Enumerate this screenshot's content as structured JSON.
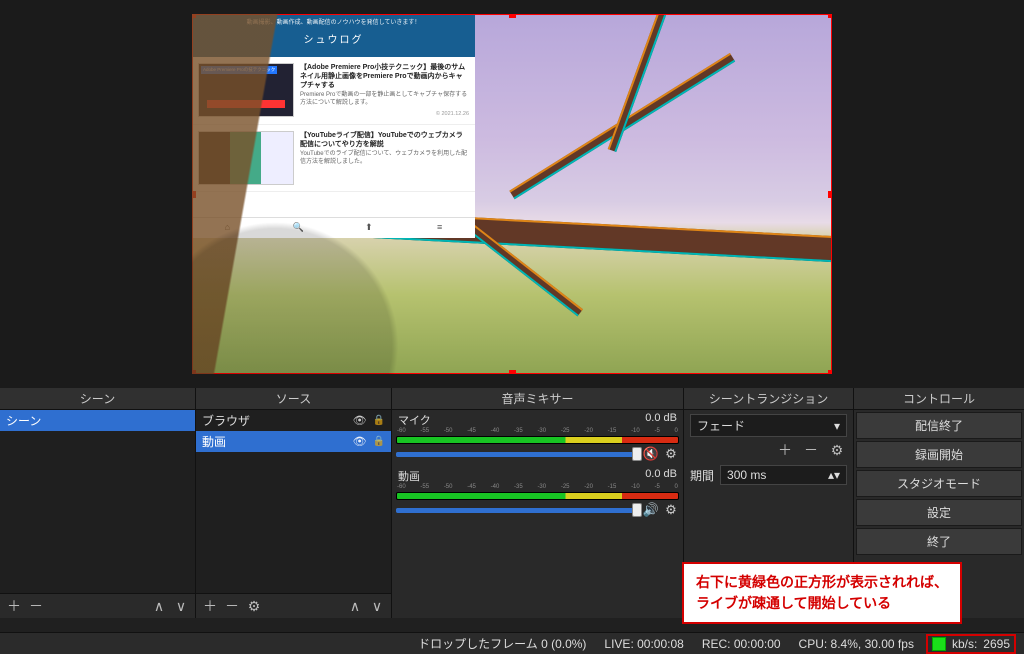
{
  "preview": {
    "browser_source": {
      "header_tagline": "動画撮影、動画作成、動画配信のノウハウを発信していきます！",
      "header_title": "シュウログ",
      "articles": [
        {
          "title": "【Adobe Premiere Pro小技テクニック】最後のサムネイル用静止画像をPremiere Proで動画内からキャプチャする",
          "desc": "Premiere Proで動画の一部を静止画としてキャプチャ保存する方法について解説します。",
          "date": "© 2021.12.26"
        },
        {
          "title": "【YouTubeライブ配信】YouTubeでのウェブカメラ配信についてやり方を解説",
          "desc": "YouTubeでのライブ配信について、ウェブカメラを利用した配信方法を解説しました。",
          "date": ""
        }
      ],
      "nav_icons": [
        "home-icon",
        "search-icon",
        "upload-icon",
        "menu-icon"
      ]
    }
  },
  "docks": {
    "scenes": {
      "title": "シーン",
      "items": [
        "シーン"
      ]
    },
    "sources": {
      "title": "ソース",
      "items": [
        {
          "name": "ブラウザ",
          "selected": false
        },
        {
          "name": "動画",
          "selected": true
        }
      ]
    },
    "mixer": {
      "title": "音声ミキサー",
      "channels": [
        {
          "name": "マイク",
          "db": "0.0 dB",
          "muted": true
        },
        {
          "name": "動画",
          "db": "0.0 dB",
          "muted": false
        }
      ],
      "scale": [
        "-60",
        "-55",
        "-50",
        "-45",
        "-40",
        "-35",
        "-30",
        "-25",
        "-20",
        "-15",
        "-10",
        "-5",
        "0"
      ]
    },
    "transitions": {
      "title": "シーントランジション",
      "type": "フェード",
      "duration_label": "期間",
      "duration_value": "300 ms"
    },
    "controls": {
      "title": "コントロール",
      "buttons": [
        "配信終了",
        "録画開始",
        "スタジオモード",
        "設定",
        "終了"
      ]
    }
  },
  "annotation": {
    "line1": "右下に黄緑色の正方形が表示されれば、",
    "line2": "ライブが疎通して開始している"
  },
  "statusbar": {
    "dropped": "ドロップしたフレーム 0 (0.0%)",
    "live": "LIVE: 00:00:08",
    "rec": "REC: 00:00:00",
    "cpu": "CPU: 8.4%, 30.00 fps",
    "bitrate_label": "kb/s:",
    "bitrate_value": "2695"
  }
}
